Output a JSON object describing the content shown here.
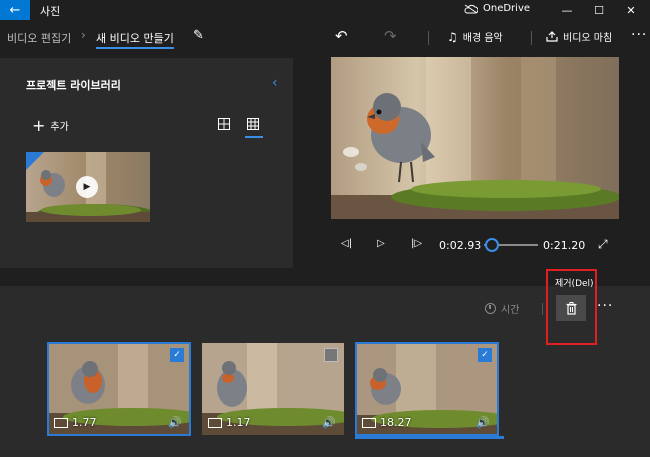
{
  "app": {
    "title": "사진",
    "onedrive_label": "OneDrive"
  },
  "nav": {
    "crumb_parent": "비디오 편집기",
    "crumb_current": "새 비디오 만들기",
    "background_music": "배경 음악",
    "finish_video": "비디오 마침"
  },
  "library": {
    "title": "프로젝트 라이브러리",
    "add_label": "추가"
  },
  "player": {
    "current_time": "0:02.93",
    "total_time": "0:21.20",
    "progress": 0.14
  },
  "storyboard": {
    "duration_label": "시간",
    "remove_tooltip": "제거(Del)",
    "clips": [
      {
        "duration": "1.77",
        "checked": true
      },
      {
        "duration": "1.17",
        "checked": false
      },
      {
        "duration": "18.27",
        "checked": true
      }
    ]
  },
  "icons": {
    "back": "arrow-left-icon",
    "edit": "pencil-icon",
    "undo": "undo-icon",
    "redo": "redo-icon",
    "music": "music-note-icon",
    "export": "share-export-icon",
    "trash": "trash-icon",
    "clock": "clock-icon"
  },
  "colors": {
    "accent": "#3b8ee6",
    "highlight": "#e02020",
    "panel": "#2b2b2b",
    "background": "#1f1f1f"
  }
}
